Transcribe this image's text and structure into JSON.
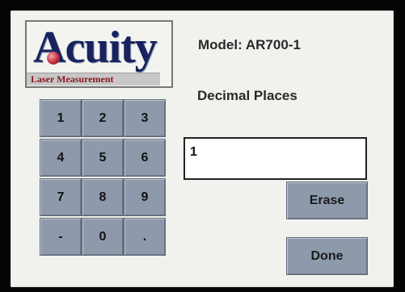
{
  "logo": {
    "brand": "Acuity",
    "tagline": "Laser Measurement"
  },
  "header": {
    "model_label": "Model:  AR700-1",
    "field_label": "Decimal Places"
  },
  "keypad": {
    "keys": [
      "1",
      "2",
      "3",
      "4",
      "5",
      "6",
      "7",
      "8",
      "9",
      "-",
      "0",
      "."
    ]
  },
  "input": {
    "value": "1"
  },
  "buttons": {
    "erase": "Erase",
    "done": "Done"
  },
  "colors": {
    "button_face": "#8e9aac",
    "screen_bg": "#f1f1ee",
    "logo_text": "#16235e",
    "tagline_text": "#8a1822"
  }
}
